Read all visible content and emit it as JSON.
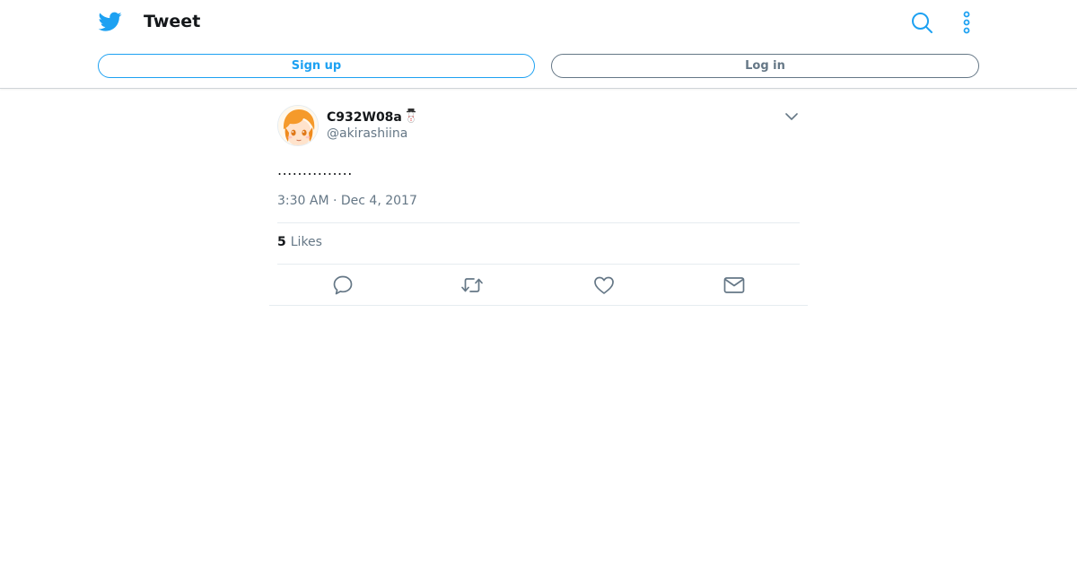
{
  "header": {
    "title": "Tweet",
    "signup_label": "Sign up",
    "login_label": "Log in"
  },
  "tweet": {
    "display_name": "C932W08a",
    "handle": "@akirashiina",
    "text": "...............",
    "timestamp": "3:30 AM · Dec 4, 2017",
    "likes_count": "5",
    "likes_label": "Likes"
  },
  "icons": {
    "logo": "twitter-bird-icon",
    "search": "search-icon",
    "more": "more-vertical-icon",
    "caret": "chevron-down-icon",
    "reply": "reply-icon",
    "retweet": "retweet-icon",
    "like": "heart-icon",
    "dm": "envelope-icon",
    "name_emoji": "snowman-icon"
  },
  "colors": {
    "accent": "#1da1f2",
    "muted": "#657786",
    "text": "#14171a",
    "border": "#e6ecf0"
  }
}
